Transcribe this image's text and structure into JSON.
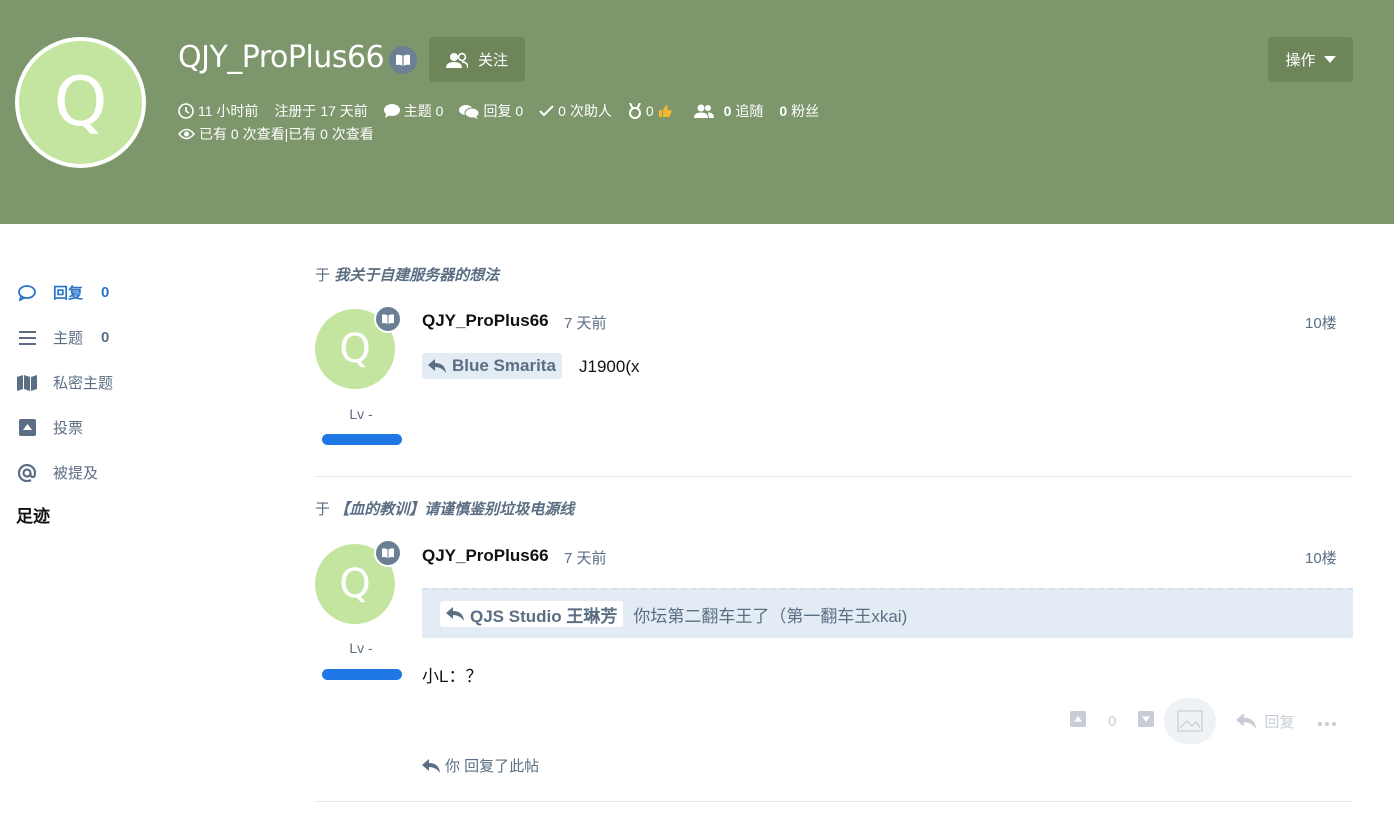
{
  "profile": {
    "avatar_letter": "Q",
    "username": "QJY_ProPlus66",
    "follow_label": "关注",
    "ops_label": "操作",
    "last_online": "11 小时前",
    "registered": "注册于 17 天前",
    "topics": "主题 0",
    "replies": "回复 0",
    "helped": "0 次助人",
    "medals": "0",
    "following_count": "0",
    "following_label": "追随",
    "followers_count": "0",
    "followers_label": "粉丝",
    "views": "已有 0 次查看|已有 0 次查看"
  },
  "sidebar": {
    "items": [
      {
        "label": "回复",
        "count": "0"
      },
      {
        "label": "主题",
        "count": "0"
      },
      {
        "label": "私密主题"
      },
      {
        "label": "投票"
      },
      {
        "label": "被提及"
      }
    ],
    "footprint": "足迹"
  },
  "posts": [
    {
      "ctx_prefix": "于",
      "thread_title": "我关于自建服务器的想法",
      "avatar_letter": "Q",
      "level": "Lv -",
      "author": "QJY_ProPlus66",
      "time": "7 天前",
      "floor": "10楼",
      "reply_to": "Blue Smarita",
      "content": "J1900(x"
    },
    {
      "ctx_prefix": "于",
      "thread_title": "【血的教训】请谨慎鉴别垃圾电源线",
      "avatar_letter": "Q",
      "level": "Lv -",
      "author": "QJY_ProPlus66",
      "time": "7 天前",
      "floor": "10楼",
      "quote_author": "QJS Studio 王琳芳",
      "quote_text": "你坛第二翻车王了（第一翻车王xkai)",
      "content": "小L：？",
      "vote_count": "0",
      "reply_label": "回复",
      "you_replied": "你 回复了此帖"
    }
  ],
  "colors": {
    "hero": "#7e966b",
    "button": "#6d8559",
    "avatar": "#c4e5a0",
    "accent": "#2a75c8",
    "muted": "#5b6e83",
    "level_bar": "#1f77e6"
  }
}
